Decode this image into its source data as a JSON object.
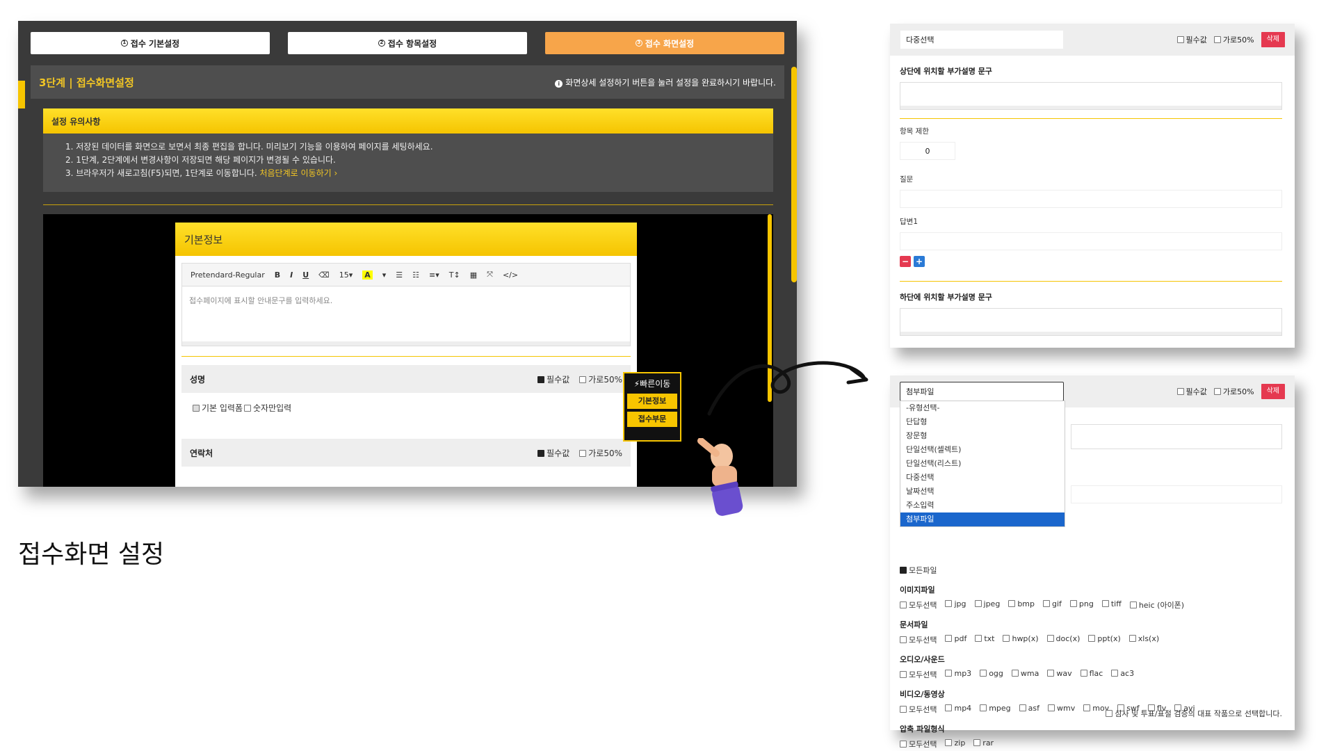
{
  "admin": {
    "steps": [
      {
        "num": "1",
        "label": "접수 기본설정"
      },
      {
        "num": "2",
        "label": "접수 항목설정"
      },
      {
        "num": "3",
        "label": "접수 화면설정"
      }
    ],
    "header_title": "3단계 | 접수화면설정",
    "header_note": "화면상세 설정하기 버튼을 눌러 설정을 완료하시기 바랍니다.",
    "notice_title": "설정 유의사항",
    "notice_items": [
      "1. 저장된 데이터를 화면으로 보면서 최종 편집을 합니다. 미리보기 기능을 이용하여 페이지를 세팅하세요.",
      "2. 1단계, 2단계에서 변경사항이 저장되면 해당 페이지가 변경될 수 있습니다.",
      "3. 브라우저가 새로고침(F5)되면, 1단계로 이동합니다."
    ],
    "notice_link": "처음단계로 이동하기 ›",
    "form_title": "기본정보",
    "toolbar": {
      "font": "Pretendard-Regular",
      "bold": "B",
      "italic": "I",
      "underline": "U",
      "eraser": "⌫",
      "size": "15▾",
      "color": "A",
      "color_caret": "▾",
      "ul": "☰",
      "ol": "☷",
      "align": "≡▾",
      "style": "T↕",
      "table": "▦",
      "fullscreen": "⤧",
      "code": "</>"
    },
    "editor_placeholder": "접수페이지에 표시할 안내문구를 입력하세요.",
    "fields": [
      {
        "label": "성명",
        "required": "필수값",
        "half": "가로50%"
      },
      {
        "label": "연락처",
        "required": "필수값",
        "half": "가로50%"
      }
    ],
    "name_opts": {
      "basic": "기본 입력폼",
      "numeric": "숫자만입력"
    },
    "quick": {
      "title": "빠른이동",
      "btn1": "기본정보",
      "btn2": "접수부문"
    }
  },
  "caption": "접수화면 설정",
  "panel1": {
    "select_value": "다중선택",
    "required": "필수값",
    "half": "가로50%",
    "delete": "삭제",
    "top_desc_label": "상단에 위치할 부가설명 문구",
    "limit_label": "항목 제한",
    "limit_value": "0",
    "question_label": "질문",
    "answer_label": "답변1",
    "minus": "−",
    "plus": "+",
    "bottom_desc_label": "하단에 위치할 부가설명 문구"
  },
  "panel2": {
    "select_value": "첨부파일",
    "required": "필수값",
    "half": "가로50%",
    "delete": "삭제",
    "dropdown": [
      "-유형선택-",
      "단답형",
      "장문형",
      "단일선택(셀렉트)",
      "단일선택(리스트)",
      "다중선택",
      "날짜선택",
      "주소입력",
      "첨부파일"
    ],
    "all_files": "모든파일",
    "groups": [
      {
        "label": "이미지파일",
        "items": [
          "모두선택",
          "jpg",
          "jpeg",
          "bmp",
          "gif",
          "png",
          "tiff",
          "heic (아이폰)"
        ]
      },
      {
        "label": "문서파일",
        "items": [
          "모두선택",
          "pdf",
          "txt",
          "hwp(x)",
          "doc(x)",
          "ppt(x)",
          "xls(x)"
        ]
      },
      {
        "label": "오디오/사운드",
        "items": [
          "모두선택",
          "mp3",
          "ogg",
          "wma",
          "wav",
          "flac",
          "ac3"
        ]
      },
      {
        "label": "비디오/동영상",
        "items": [
          "모두선택",
          "mp4",
          "mpeg",
          "asf",
          "wmv",
          "mov",
          "swf",
          "flv",
          "avi"
        ]
      },
      {
        "label": "압축 파일형식",
        "items": [
          "모두선택",
          "zip",
          "rar"
        ]
      }
    ],
    "final_note": "심사 및 투표/표절 검증의 대표 작품으로 선택합니다."
  }
}
